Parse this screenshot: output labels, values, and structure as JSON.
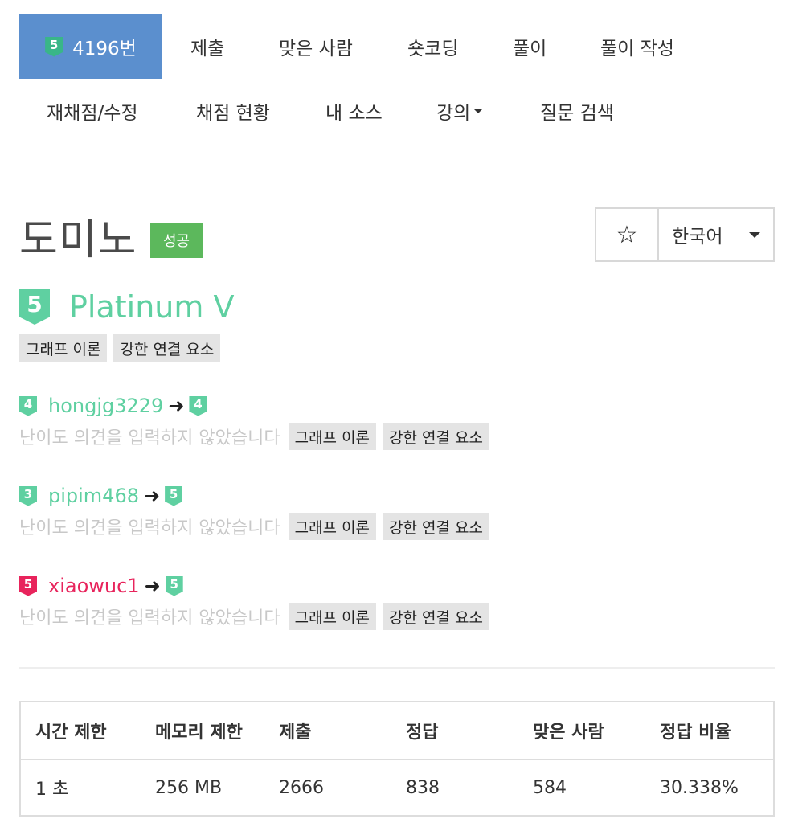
{
  "nav": {
    "row1": [
      {
        "badge": "5",
        "label": "4196번",
        "active": true
      },
      {
        "label": "제출"
      },
      {
        "label": "맞은 사람"
      },
      {
        "label": "숏코딩"
      },
      {
        "label": "풀이"
      },
      {
        "label": "풀이 작성"
      }
    ],
    "row2": [
      {
        "label": "재채점/수정"
      },
      {
        "label": "채점 현황"
      },
      {
        "label": "내 소스"
      },
      {
        "label": "강의"
      },
      {
        "label": "질문 검색"
      }
    ]
  },
  "problem": {
    "title": "도미노",
    "status": "성공",
    "star_icon": "☆",
    "language": "한국어",
    "tier_badge": "5",
    "tier_name": "Platinum V",
    "tags": [
      "그래프 이론",
      "강한 연결 요소"
    ],
    "colors": {
      "platinum": "#5fd0a1",
      "ruby": "#e8245c",
      "success": "#5cb85c",
      "active_nav": "#5b8fce"
    }
  },
  "opinions": [
    {
      "from_badge": "4",
      "user": "hongjg3229",
      "arrow": "➜",
      "to_badge": "4",
      "note": "난이도 의견을 입력하지 않았습니다",
      "tags": [
        "그래프 이론",
        "강한 연결 요소"
      ]
    },
    {
      "from_badge": "3",
      "user": "pipim468",
      "arrow": "➜",
      "to_badge": "5",
      "note": "난이도 의견을 입력하지 않았습니다",
      "tags": [
        "그래프 이론",
        "강한 연결 요소"
      ]
    },
    {
      "from_badge": "5",
      "user": "xiaowuc1",
      "arrow": "➜",
      "to_badge": "5",
      "note": "난이도 의견을 입력하지 않았습니다",
      "tags": [
        "그래프 이론",
        "강한 연결 요소"
      ]
    }
  ],
  "stats": {
    "headers": [
      "시간 제한",
      "메모리 제한",
      "제출",
      "정답",
      "맞은 사람",
      "정답 비율"
    ],
    "values": [
      "1 초",
      "256 MB",
      "2666",
      "838",
      "584",
      "30.338%"
    ]
  }
}
